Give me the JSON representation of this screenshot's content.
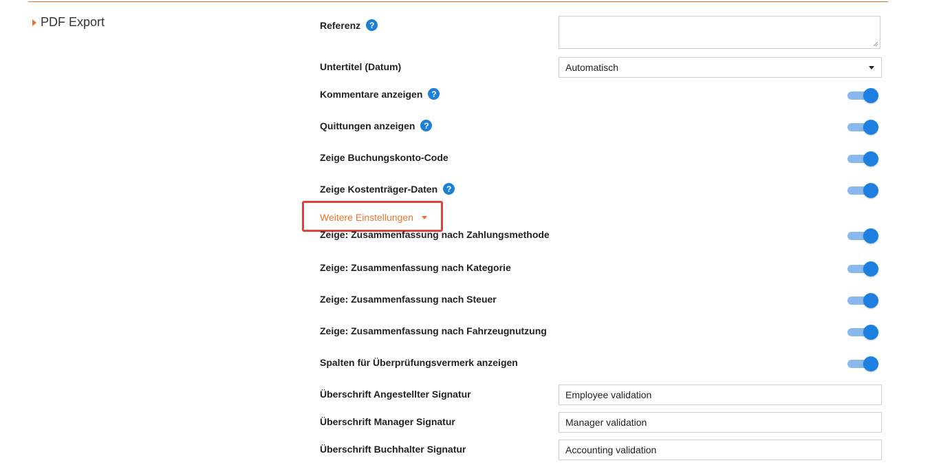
{
  "section": {
    "title": "PDF Export"
  },
  "fields": {
    "referenz": {
      "label": "Referenz",
      "value": ""
    },
    "untertitel": {
      "label": "Untertitel (Datum)",
      "value": "Automatisch"
    }
  },
  "toggles": {
    "kommentare": {
      "label": "Kommentare anzeigen",
      "on": true
    },
    "quittungen": {
      "label": "Quittungen anzeigen",
      "on": true
    },
    "buchungskonto": {
      "label": "Zeige Buchungskonto-Code",
      "on": true
    },
    "kostentraeger": {
      "label": "Zeige Kostenträger-Daten",
      "on": true
    },
    "zahlungsmethode": {
      "label": "Zeige: Zusammenfassung nach Zahlungsmethode",
      "on": true
    },
    "kategorie": {
      "label": "Zeige: Zusammenfassung nach Kategorie",
      "on": true
    },
    "steuer": {
      "label": "Zeige: Zusammenfassung nach Steuer",
      "on": true
    },
    "fahrzeugnutzung": {
      "label": "Zeige: Zusammenfassung nach Fahrzeugnutzung",
      "on": true
    },
    "pruefungsvermerk": {
      "label": "Spalten für Überprüfungsvermerk anzeigen",
      "on": true
    }
  },
  "more_settings": {
    "label": "Weitere Einstellungen"
  },
  "signatures": {
    "employee": {
      "label": "Überschrift Angestellter Signatur",
      "value": "Employee validation"
    },
    "manager": {
      "label": "Überschrift Manager Signatur",
      "value": "Manager validation"
    },
    "accountant": {
      "label": "Überschrift Buchhalter Signatur",
      "value": "Accounting validation"
    }
  },
  "icons": {
    "help": "?"
  },
  "colors": {
    "accent": "#e8742f",
    "toggle_on": "#1e7fe0",
    "help_icon": "#1e7fd6",
    "highlight": "#e0403a"
  }
}
